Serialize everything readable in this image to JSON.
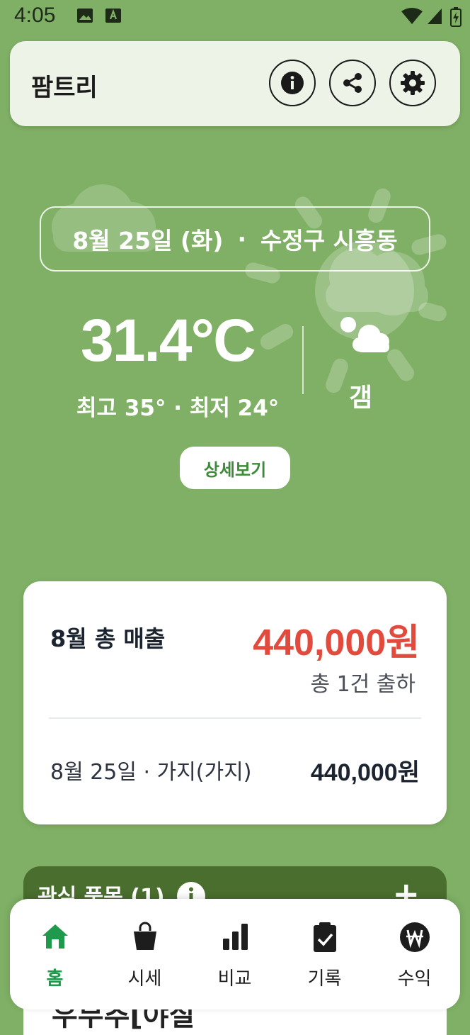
{
  "status_bar": {
    "time": "4:05"
  },
  "app_bar": {
    "title": "팜트리"
  },
  "weather": {
    "date": "8월 25일 (화)",
    "separator": "·",
    "location": "수정구 시흥동",
    "temperature": "31.4°C",
    "high_low": "최고 35° · 최저 24°",
    "condition": "갬",
    "detail_button": "상세보기"
  },
  "sales": {
    "label": "8월 총 매출",
    "amount": "440,000원",
    "count": "총 1건 출하",
    "entry_label": "8월 25일 · 가지(가지)",
    "entry_amount": "440,000원"
  },
  "interest": {
    "title": "관심 품목 (1)",
    "add": "+",
    "peek_text": "우무추[야질"
  },
  "bottom_nav": {
    "items": [
      {
        "label": "홈",
        "icon": "home-icon"
      },
      {
        "label": "시세",
        "icon": "shopping-bag-icon"
      },
      {
        "label": "비교",
        "icon": "bar-chart-icon"
      },
      {
        "label": "기록",
        "icon": "clipboard-check-icon"
      },
      {
        "label": "수익",
        "icon": "won-coin-icon"
      }
    ],
    "active_index": 0
  },
  "colors": {
    "background": "#7fb065",
    "accent_green": "#1f9a4c",
    "sales_red": "#e14a3c",
    "interest_header": "#4a6e2e"
  }
}
